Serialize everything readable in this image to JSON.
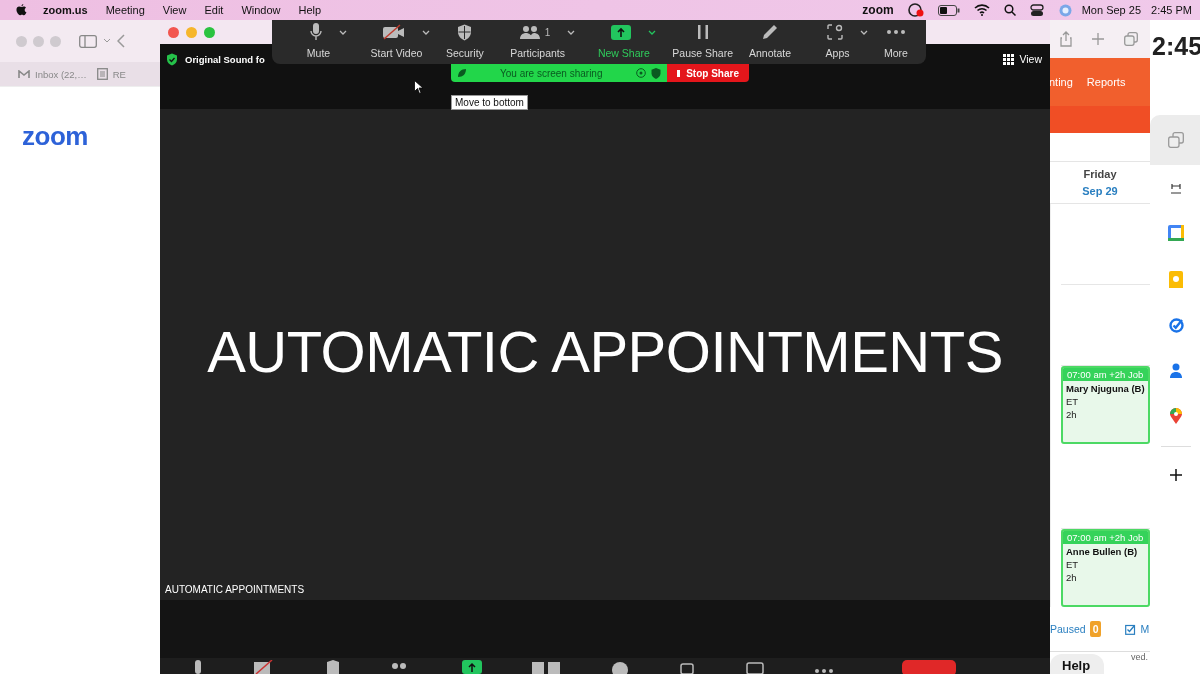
{
  "menu_bar": {
    "app": "zoom.us",
    "menus": [
      "Meeting",
      "View",
      "Edit",
      "Window",
      "Help"
    ],
    "status_app": "zoom",
    "date": "Mon Sep 25",
    "time": "2:45 PM"
  },
  "left_browser": {
    "tabs": [
      {
        "label": "Inbox (22,…",
        "kind": "mail"
      },
      {
        "label": "RE",
        "kind": "doc"
      }
    ],
    "logo": "zoom"
  },
  "meeting_window": {
    "audio_label": "Original Sound fo",
    "view_button": "View",
    "shared_title": "AUTOMATIC APPOINTMENTS",
    "caption": "AUTOMATIC APPOINTMENTS"
  },
  "floating_toolbar": {
    "buttons": [
      {
        "label": "Mute",
        "kind": "mic",
        "menu": true,
        "highlighted": false
      },
      {
        "label": "Start Video",
        "kind": "video",
        "menu": true,
        "highlighted": false
      },
      {
        "label": "Security",
        "kind": "shield",
        "menu": false,
        "highlighted": false
      },
      {
        "label": "Participants",
        "kind": "people",
        "count": "1",
        "menu": true,
        "highlighted": false
      },
      {
        "label": "New Share",
        "kind": "share",
        "menu": true,
        "highlighted": true
      },
      {
        "label": "Pause Share",
        "kind": "pause",
        "menu": false,
        "highlighted": false
      },
      {
        "label": "Annotate",
        "kind": "pencil",
        "menu": false,
        "highlighted": false
      },
      {
        "label": "Apps",
        "kind": "apps",
        "menu": true,
        "highlighted": false
      },
      {
        "label": "More",
        "kind": "more",
        "menu": false,
        "highlighted": false
      }
    ]
  },
  "share_banner": {
    "status": "You are screen sharing",
    "stop": "Stop Share"
  },
  "tooltip": "Move to bottom",
  "right_browser": {
    "nav": [
      "nting",
      "Reports"
    ],
    "day": "Friday",
    "date": "Sep 29",
    "events": [
      {
        "time": "07:00 am +2h Job",
        "name": "Mary Njuguna (B)",
        "code": "ET",
        "duration": "2h"
      },
      {
        "time": "07:00 am +2h Job",
        "name": "Anne Bullen (B)",
        "code": "ET",
        "duration": "2h"
      }
    ],
    "paused_label": "Paused",
    "paused_count": "0",
    "footer_link": "M",
    "note": "ved.",
    "help": "Help"
  },
  "side_window": {
    "clock": "2:45"
  }
}
